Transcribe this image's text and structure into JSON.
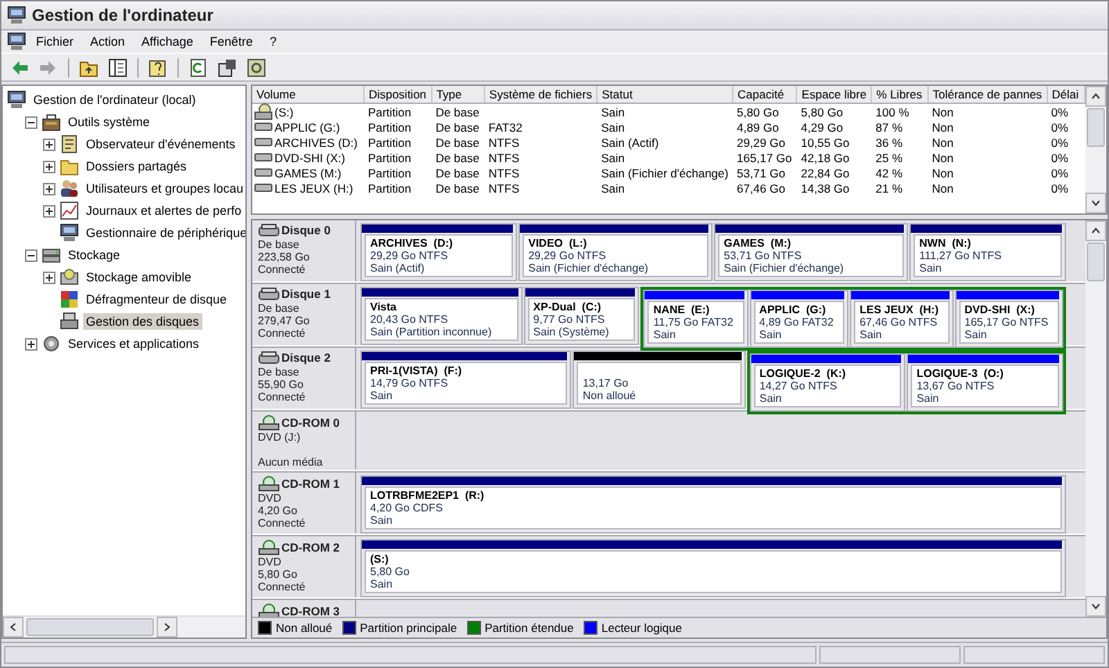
{
  "window": {
    "title": "Gestion de l'ordinateur"
  },
  "menu": [
    "Fichier",
    "Action",
    "Affichage",
    "Fenêtre",
    "?"
  ],
  "toolbar": [
    {
      "kind": "back",
      "disabled": false
    },
    {
      "kind": "forward",
      "disabled": true
    },
    {
      "kind": "sep"
    },
    {
      "kind": "up"
    },
    {
      "kind": "tree"
    },
    {
      "kind": "sep"
    },
    {
      "kind": "help"
    },
    {
      "kind": "sep"
    },
    {
      "kind": "refresh"
    },
    {
      "kind": "properties"
    },
    {
      "kind": "manage"
    }
  ],
  "tree": {
    "label": "Gestion de l'ordinateur (local)",
    "selected": false,
    "children": [
      {
        "label": "Outils système",
        "expanded": true,
        "selected": false,
        "children": [
          {
            "label": "Observateur d'événements",
            "expanded": false,
            "selected": false
          },
          {
            "label": "Dossiers partagés",
            "expanded": false,
            "selected": false
          },
          {
            "label": "Utilisateurs et groupes locau",
            "expanded": false,
            "selected": false
          },
          {
            "label": "Journaux et alertes de perfo",
            "expanded": false,
            "selected": false
          },
          {
            "label": "Gestionnaire de périphérique",
            "selected": false
          }
        ]
      },
      {
        "label": "Stockage",
        "expanded": true,
        "selected": false,
        "children": [
          {
            "label": "Stockage amovible",
            "expanded": false,
            "selected": false
          },
          {
            "label": "Défragmenteur de disque",
            "selected": false
          },
          {
            "label": "Gestion des disques",
            "selected": true
          }
        ]
      },
      {
        "label": "Services et applications",
        "expanded": false,
        "selected": false
      }
    ]
  },
  "table": {
    "columns": [
      "Volume",
      "Disposition",
      "Type",
      "Système de fichiers",
      "Statut",
      "Capacité",
      "Espace libre",
      "% Libres",
      "Tolérance de pannes",
      "Délai"
    ],
    "rows": [
      {
        "kind": "cdrom",
        "cells": [
          "(S:)",
          "Partition",
          "De base",
          "",
          "Sain",
          "5,80 Go",
          "5,80 Go",
          "100 %",
          "Non",
          "0%"
        ]
      },
      {
        "kind": "disk",
        "cells": [
          "APPLIC (G:)",
          "Partition",
          "De base",
          "FAT32",
          "Sain",
          "4,89 Go",
          "4,29 Go",
          "87 %",
          "Non",
          "0%"
        ]
      },
      {
        "kind": "disk",
        "cells": [
          "ARCHIVES (D:)",
          "Partition",
          "De base",
          "NTFS",
          "Sain (Actif)",
          "29,29 Go",
          "10,55 Go",
          "36 %",
          "Non",
          "0%"
        ]
      },
      {
        "kind": "disk",
        "cells": [
          "DVD-SHI (X:)",
          "Partition",
          "De base",
          "NTFS",
          "Sain",
          "165,17 Go",
          "42,18 Go",
          "25 %",
          "Non",
          "0%"
        ]
      },
      {
        "kind": "disk",
        "cells": [
          "GAMES (M:)",
          "Partition",
          "De base",
          "NTFS",
          "Sain (Fichier d'échange)",
          "53,71 Go",
          "22,84 Go",
          "42 %",
          "Non",
          "0%"
        ]
      },
      {
        "kind": "disk",
        "cells": [
          "LES JEUX (H:)",
          "Partition",
          "De base",
          "NTFS",
          "Sain",
          "67,46 Go",
          "14,38 Go",
          "21 %",
          "Non",
          "0%"
        ]
      }
    ]
  },
  "disks": [
    {
      "kind": "disk",
      "name": "Disque 0",
      "type": "De base",
      "size": "223,58 Go",
      "status": "Connecté",
      "partitions": [
        {
          "kind": "primary",
          "name": "ARCHIVES  (D:)",
          "size": "29,29 Go NTFS",
          "status": "Sain (Actif)"
        },
        {
          "kind": "primary",
          "name": "VIDEO  (L:)",
          "size": "29,29 Go NTFS",
          "status": "Sain (Fichier d'échange)"
        },
        {
          "kind": "primary",
          "name": "GAMES  (M:)",
          "size": "53,71 Go NTFS",
          "status": "Sain (Fichier d'échange)"
        },
        {
          "kind": "primary",
          "name": "NWN  (N:)",
          "size": "111,27 Go NTFS",
          "status": "Sain"
        }
      ]
    },
    {
      "kind": "disk",
      "name": "Disque 1",
      "type": "De base",
      "size": "279,47 Go",
      "status": "Connecté",
      "partitions": [
        {
          "kind": "primary",
          "name": "Vista",
          "size": "20,43 Go NTFS",
          "status": "Sain (Partition inconnue)"
        },
        {
          "kind": "primary",
          "name": "XP-Dual  (C:)",
          "size": "9,77 Go NTFS",
          "status": "Sain (Système)"
        },
        {
          "kind": "extended",
          "children": [
            {
              "kind": "logical",
              "name": "NANE  (E:)",
              "size": "11,75 Go FAT32",
              "status": "Sain"
            },
            {
              "kind": "logical",
              "name": "APPLIC  (G:)",
              "size": "4,89 Go FAT32",
              "status": "Sain"
            },
            {
              "kind": "logical",
              "name": "LES JEUX  (H:)",
              "size": "67,46 Go NTFS",
              "status": "Sain"
            },
            {
              "kind": "logical",
              "name": "DVD-SHI  (X:)",
              "size": "165,17 Go NTFS",
              "status": "Sain"
            }
          ]
        }
      ]
    },
    {
      "kind": "disk",
      "name": "Disque 2",
      "type": "De base",
      "size": "55,90 Go",
      "status": "Connecté",
      "partitions": [
        {
          "kind": "primary",
          "name": "PRI-1(VISTA)  (F:)",
          "size": "14,79 Go NTFS",
          "status": "Sain"
        },
        {
          "kind": "unallocated",
          "size": "13,17 Go",
          "status": "Non alloué"
        },
        {
          "kind": "extended",
          "children": [
            {
              "kind": "logical",
              "name": "LOGIQUE-2  (K:)",
              "size": "14,27 Go NTFS",
              "status": "Sain"
            },
            {
              "kind": "logical",
              "name": "LOGIQUE-3  (O:)",
              "size": "13,67 Go NTFS",
              "status": "Sain"
            }
          ]
        }
      ]
    },
    {
      "kind": "cdrom",
      "name": "CD-ROM 0",
      "type": "DVD (J:)",
      "status": "Aucun média"
    },
    {
      "kind": "cdrom",
      "name": "CD-ROM 1",
      "type": "DVD",
      "size": "4,20 Go",
      "status": "Connecté",
      "partitions": [
        {
          "kind": "primary",
          "name": "LOTRBFME2EP1  (R:)",
          "size": "4,20 Go CDFS",
          "status": "Sain"
        }
      ]
    },
    {
      "kind": "cdrom",
      "name": "CD-ROM 2",
      "type": "DVD",
      "size": "5,80 Go",
      "status": "Connecté",
      "partitions": [
        {
          "kind": "primary",
          "name": "(S:)",
          "size": "5,80 Go",
          "status": "Sain"
        }
      ]
    },
    {
      "kind": "cdrom",
      "name": "CD-ROM 3"
    }
  ],
  "legend": [
    {
      "label": "Non alloué",
      "color": "#000000"
    },
    {
      "label": "Partition principale",
      "color": "#000080"
    },
    {
      "label": "Partition étendue",
      "color": "#008000"
    },
    {
      "label": "Lecteur logique",
      "color": "#0000ff"
    }
  ]
}
